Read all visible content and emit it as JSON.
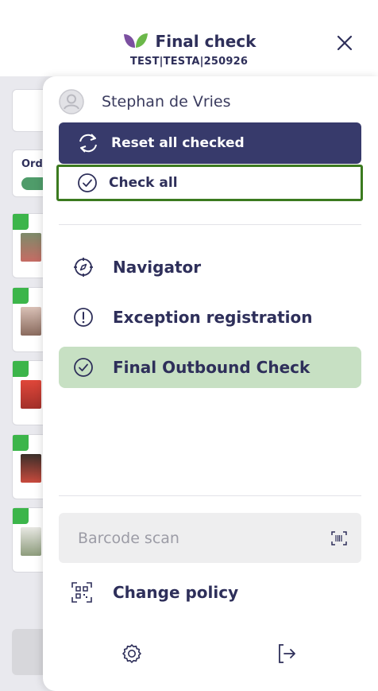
{
  "header": {
    "title": "Final check",
    "subtitle": "TEST|TESTA|250926",
    "logo_icon": "leaf-logo-icon",
    "close_icon": "close-icon"
  },
  "drawer": {
    "user": {
      "name": "Stephan de Vries",
      "icon": "user-avatar-icon"
    },
    "reset_all_checked": {
      "label": "Reset all checked",
      "icon": "refresh-icon"
    },
    "check_all": {
      "label": "Check all",
      "icon": "check-circle-icon"
    },
    "nav": [
      {
        "label": "Navigator",
        "icon": "compass-icon",
        "active": false
      },
      {
        "label": "Exception registration",
        "icon": "exclamation-circle-icon",
        "active": false
      },
      {
        "label": "Final Outbound Check",
        "icon": "check-circle-icon",
        "active": true
      }
    ],
    "barcode": {
      "placeholder": "Barcode scan",
      "value": "",
      "icon": "barcode-scan-icon"
    },
    "change_policy": {
      "label": "Change policy",
      "icon": "qr-code-icon"
    },
    "footer_icons": [
      "settings-icon",
      "logout-icon"
    ]
  },
  "background": {
    "column_label": "Ord",
    "cards_checked": 5
  },
  "colors": {
    "primary": "#373a6b",
    "active_bg": "#c7e0c3",
    "check_all_border": "#3b7a1f",
    "check_green": "#3cb54a",
    "logo_purple": "#7b4fa0",
    "logo_green": "#6bb84a"
  }
}
